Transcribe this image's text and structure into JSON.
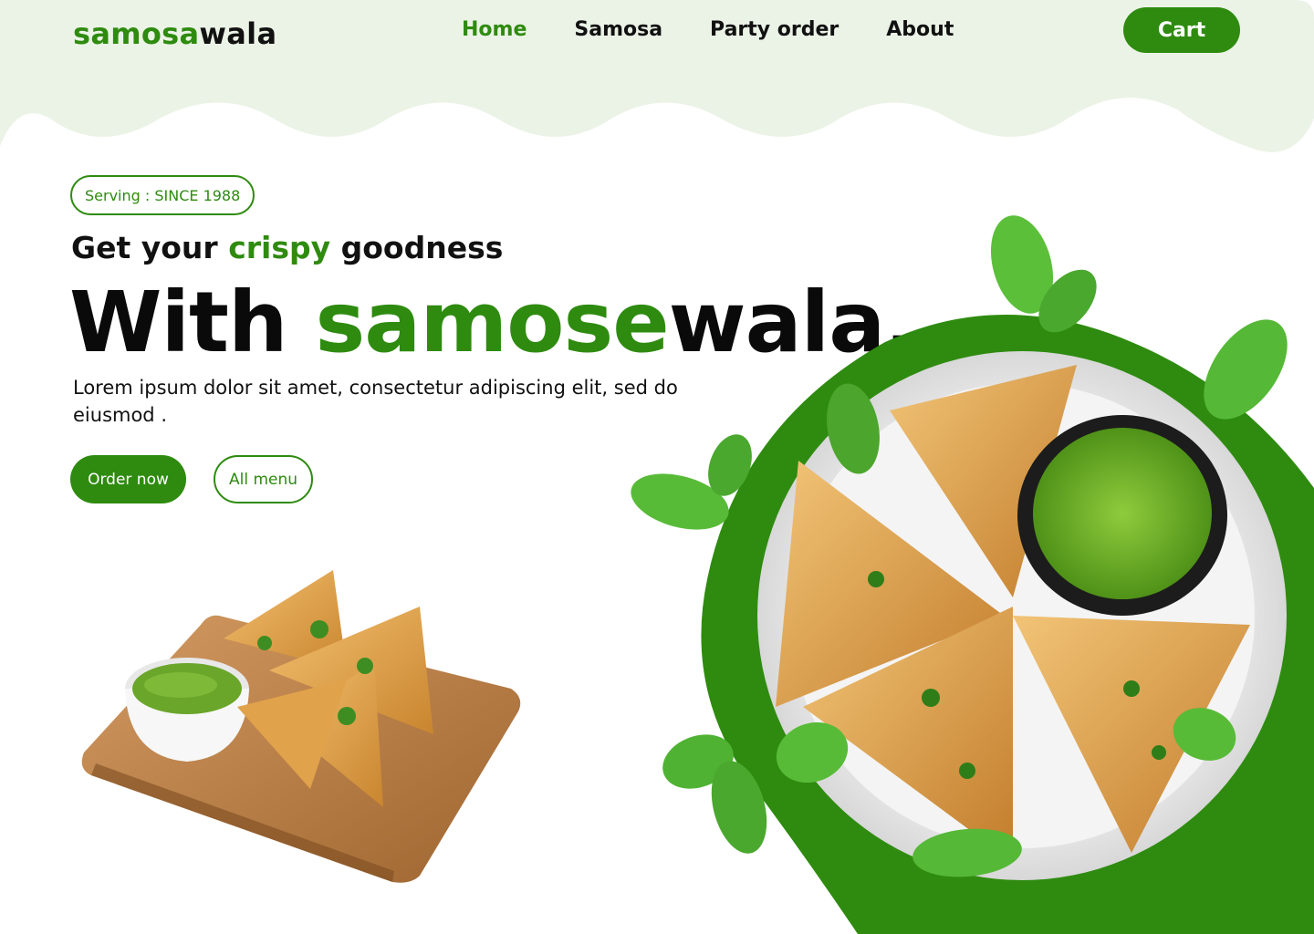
{
  "brand": {
    "part1": "samosa",
    "part2": "wala"
  },
  "nav": {
    "items": [
      {
        "label": "Home",
        "active": true
      },
      {
        "label": "Samosa",
        "active": false
      },
      {
        "label": "Party order",
        "active": false
      },
      {
        "label": "About",
        "active": false
      }
    ]
  },
  "cart": {
    "label": "Cart"
  },
  "hero": {
    "badge": "Serving : SINCE 1988",
    "tagline_pre": "Get your",
    "tagline_highlight": "crispy",
    "tagline_post": "goodness",
    "headline_pre": "With",
    "headline_highlight": "samose",
    "headline_post": "wala.",
    "description": "Lorem ipsum dolor sit amet, consectetur adipiscing elit, sed do eiusmod .",
    "primary_button": "Order now",
    "secondary_button": "All menu"
  },
  "colors": {
    "accent": "#2e8b0f",
    "band": "#ebf3e6",
    "text": "#111111"
  },
  "images": [
    {
      "name": "samosa-board-image"
    },
    {
      "name": "samosa-plate-image"
    }
  ]
}
